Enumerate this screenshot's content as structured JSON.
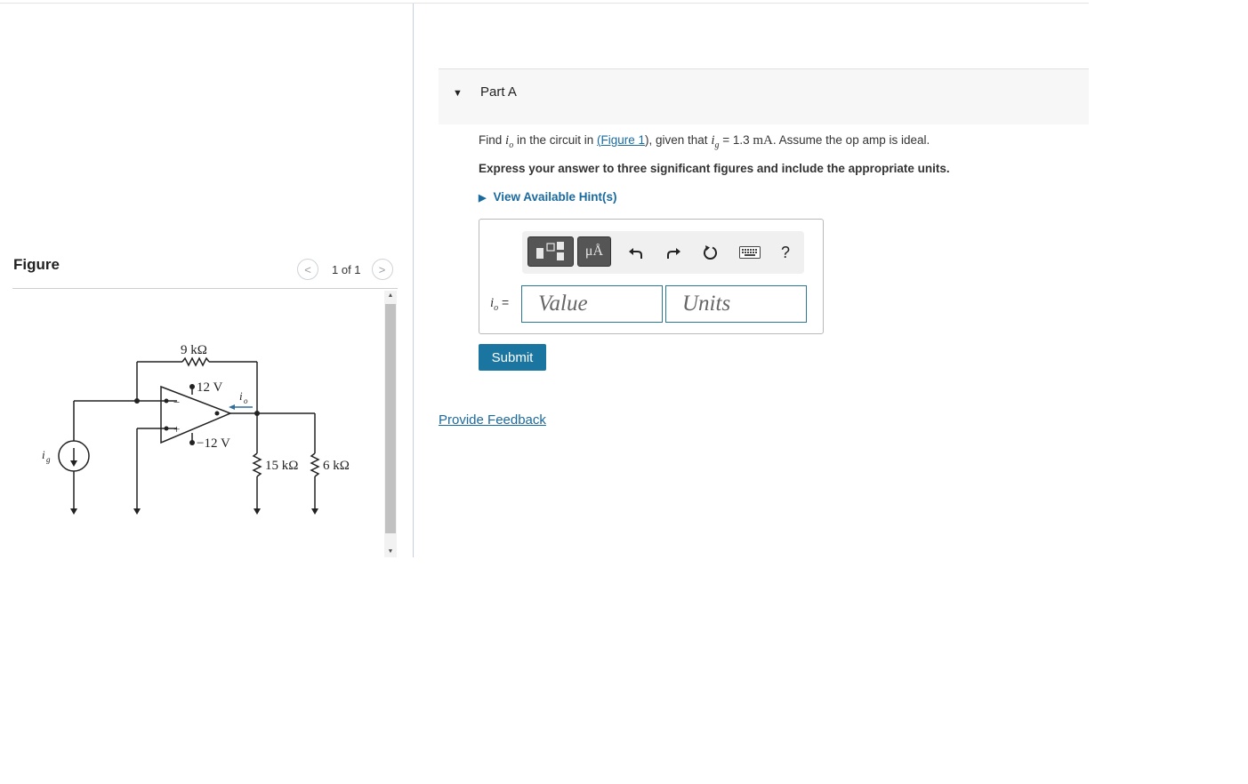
{
  "figure_panel": {
    "heading": "Figure",
    "page_count": "1 of 1",
    "prev_icon": "chevron-left-icon",
    "next_icon": "chevron-right-icon",
    "circuit_labels": {
      "feedback_resistor": "9 kΩ",
      "pos_supply": "12 V",
      "neg_supply": "−12 V",
      "output_current": "i",
      "output_current_sub": "o",
      "source_current": "i",
      "source_current_sub": "g",
      "minus_sign": "−",
      "plus_sign": "+",
      "load_resistor_1": "15 kΩ",
      "load_resistor_2": "6 kΩ"
    }
  },
  "part": {
    "title": "Part A",
    "question": {
      "prefix": "Find ",
      "var_main": "i",
      "var_sub": "o",
      "mid": " in the circuit in ",
      "link_open": "(",
      "link_text": "Figure 1",
      "link_close": ")",
      "mid2": ", given that ",
      "given_var": "i",
      "given_sub": "g",
      "given_eq": " = 1.3 ",
      "given_unit": "mA",
      "suffix": ". Assume the op amp is ideal."
    },
    "instruction": "Express your answer to three significant figures and include the appropriate units.",
    "hints_label": "View Available Hint(s)",
    "answer": {
      "label_var": "i",
      "label_sub": "o",
      "label_eq": " =",
      "value_placeholder": "Value",
      "units_placeholder": "Units"
    },
    "toolbar": {
      "units_button": "μÅ",
      "help": "?",
      "icons": [
        "templates-icon",
        "units-icon",
        "undo-icon",
        "redo-icon",
        "reset-icon",
        "keyboard-icon",
        "help-icon"
      ]
    },
    "submit_label": "Submit",
    "feedback_label": "Provide Feedback"
  }
}
